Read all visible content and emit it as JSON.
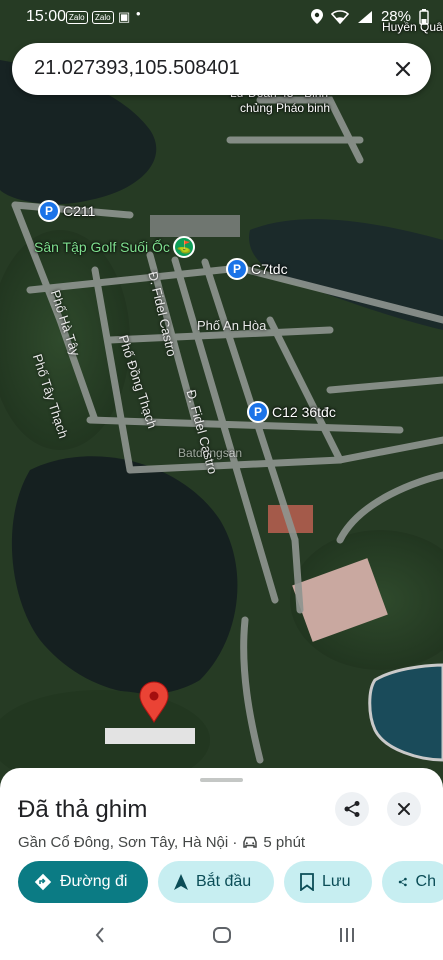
{
  "status_bar": {
    "time": "15:00",
    "app_icons": [
      "Zalo",
      "Zalo"
    ],
    "battery": "28%",
    "icons": [
      "location-icon",
      "wifi-icon",
      "signal-icon",
      "battery-icon"
    ]
  },
  "search": {
    "query": "21.027393,105.508401"
  },
  "map": {
    "labels": {
      "brigade": "Lữ Đoàn 45 - Binh",
      "brigade_2": "chủng Pháo binh",
      "village": "Huyền Quân",
      "golf": "Sân Tập Golf Suối Ốc",
      "p_c211": "C211",
      "p_c7": "C7tdc",
      "p_c12": "C12 36tđc",
      "road_ha_tay": "Phố Hà Tây",
      "road_dong_thach": "Phố Đồng Thạch",
      "road_tay_thach": "Phố Tây Thạch",
      "road_fidel_1": "Đ. Fidel Castro",
      "road_fidel_2": "Đ. Fidel Castro",
      "road_an_hoa": "Phố An Hòa"
    },
    "watermark": "Batdongsan"
  },
  "place": {
    "title": "Đã thả ghim",
    "address": "Gần Cổ Đông, Sơn Tây, Hà Nội · ",
    "drive_time": "5 phút"
  },
  "actions": {
    "directions": "Đường đi",
    "start": "Bắt đầu",
    "save": "Lưu",
    "share": "Ch"
  },
  "colors": {
    "primary": "#0b7b84",
    "secondary": "#c7eef1",
    "pin": "#ea4335",
    "parking": "#1a73e8"
  }
}
